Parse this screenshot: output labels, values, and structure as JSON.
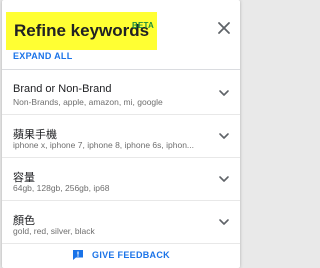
{
  "header": {
    "title": "Refine keywords",
    "badge": "BETA",
    "close_icon": "close-icon",
    "expand_all_label": "EXPAND ALL"
  },
  "filters": [
    {
      "label": "Brand or Non-Brand",
      "values": "Non-Brands, apple, amazon, mi, google"
    },
    {
      "label": "蘋果手機",
      "values": "iphone x, iphone 7, iphone 8, iphone 6s, iphon..."
    },
    {
      "label": "容量",
      "values": "64gb, 128gb, 256gb, ip68"
    },
    {
      "label": "顏色",
      "values": "gold, red, silver, black"
    }
  ],
  "footer": {
    "feedback_label": "GIVE FEEDBACK",
    "feedback_icon": "feedback-icon"
  },
  "colors": {
    "highlight": "#ffff33",
    "accent_blue": "#1a73e8",
    "beta_green": "#1e8e3e"
  }
}
